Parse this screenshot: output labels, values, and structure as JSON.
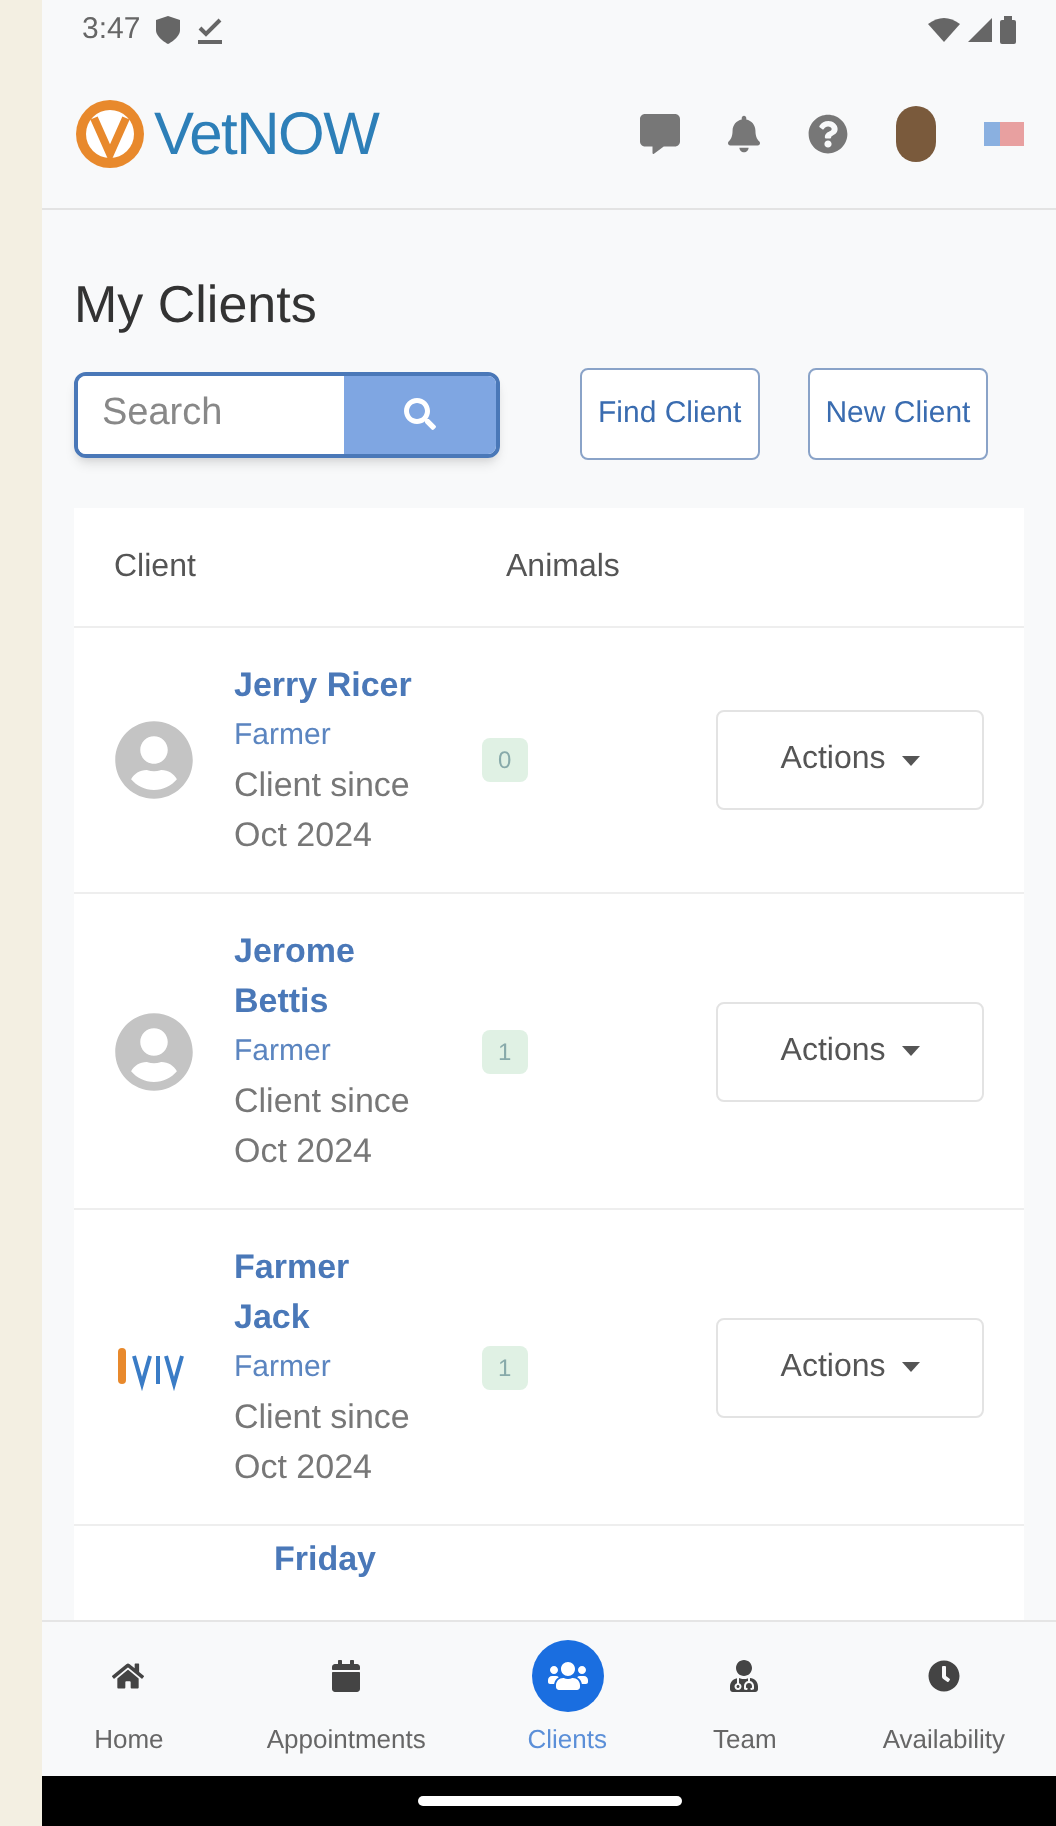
{
  "status_bar": {
    "time": "3:47"
  },
  "header": {
    "brand": "VetNOW"
  },
  "page": {
    "title": "My Clients"
  },
  "search": {
    "placeholder": "Search"
  },
  "buttons": [
    "Find Client",
    "New Client"
  ],
  "table": {
    "columns": [
      "Client",
      "Animals"
    ],
    "rows": [
      {
        "name": "Jerry Ricer",
        "role": "Farmer",
        "since": "Client since Oct 2024",
        "animals": "0",
        "action": "Actions",
        "kind": "silhouette"
      },
      {
        "name": "Jerome Bettis",
        "role": "Farmer",
        "since": "Client since Oct 2024",
        "animals": "1",
        "action": "Actions",
        "kind": "silhouette"
      },
      {
        "name": "Farmer Jack",
        "role": "Farmer",
        "since": "Client since Oct 2024",
        "animals": "1",
        "action": "Actions",
        "kind": "logo"
      }
    ],
    "partial_row": {
      "name": "Friday"
    }
  },
  "nav": [
    {
      "label": "Home",
      "selected": false
    },
    {
      "label": "Appointments",
      "selected": false
    },
    {
      "label": "Clients",
      "selected": true
    },
    {
      "label": "Team",
      "selected": false
    },
    {
      "label": "Availability",
      "selected": false
    }
  ]
}
